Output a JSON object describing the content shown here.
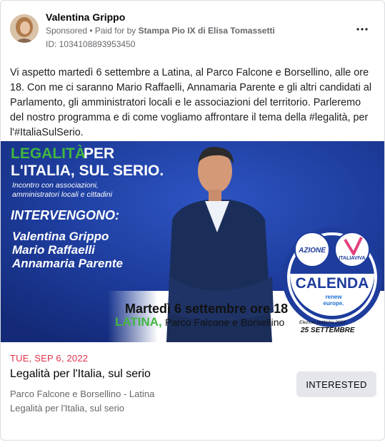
{
  "post": {
    "page_name": "Valentina Grippo",
    "sponsored_label": "Sponsored",
    "paid_for_prefix": "• Paid for by",
    "paid_for_by": "Stampa Pio IX di Elisa Tomassetti",
    "ad_id": "ID: 1034108893953450",
    "body_text": "Vi aspetto martedì 6 settembre a Latina, al Parco Falcone e Borsellino, alle ore 18. Con me ci saranno Mario Raffaelli, Annamaria Parente e gli altri candidati al Parlamento, gli amministratori locali e le associazioni del territorio. Parleremo del nostro programma e di come vogliamo affrontare il tema della #legalità, per l'#ItaliaSulSerio."
  },
  "creative": {
    "headline_green": "LEGALITÀ",
    "headline_white_1": "PER",
    "headline_white_2": "L'ITALIA, SUL SERIO.",
    "subhead_1": "Incontro con associazioni,",
    "subhead_2": "amministratori locali e cittadini",
    "speakers_title": "INTERVENGONO:",
    "speakers": [
      "Valentina Grippo",
      "Mario Raffaelli",
      "Annamaria Parente"
    ],
    "date_line": "Martedì 6 settembre ore 18",
    "city": "LATINA,",
    "place": "Parco Falcone e Borsellino",
    "logo_azione": "AZIONE",
    "logo_iv": "ITALIAVIVA",
    "logo_name": "CALENDA",
    "logo_renew_1": "renew",
    "logo_renew_2": "europe.",
    "elections_line": "Elezioni politiche 2022",
    "elections_date": "25 SETTEMBRE"
  },
  "event": {
    "date": "TUE, SEP 6, 2022",
    "title": "Legalità per l'Italia, sul serio",
    "location": "Parco Falcone e Borsellino - Latina",
    "description": "Legalità per l'Italia, sul serio",
    "interested_label": "INTERESTED"
  },
  "colors": {
    "banner_blue": "#1d3c9c",
    "headline_green": "#42b740",
    "date_red": "#e0344b",
    "button_gray": "#e4e6eb"
  },
  "icons": [
    "more-horizontal-icon"
  ]
}
